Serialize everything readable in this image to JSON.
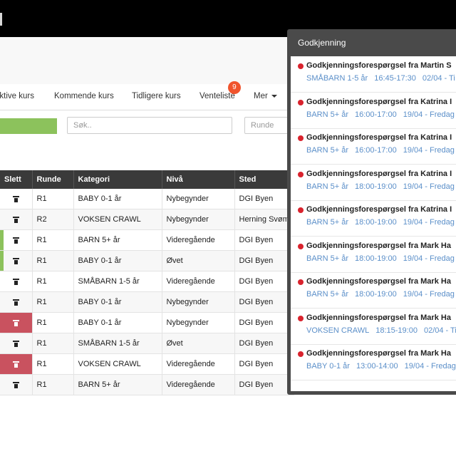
{
  "tabs": [
    {
      "label": "ktive kurs",
      "name": "tab-aktive-kurs"
    },
    {
      "label": "Kommende kurs",
      "name": "tab-kommende-kurs"
    },
    {
      "label": "Tidligere kurs",
      "name": "tab-tidligere-kurs"
    },
    {
      "label": "Venteliste",
      "name": "tab-venteliste",
      "badge": "9"
    },
    {
      "label": "Mer",
      "name": "tab-mer"
    }
  ],
  "search": {
    "placeholder": "Søk.."
  },
  "runde_filter": {
    "placeholder": "Runde"
  },
  "table": {
    "columns": [
      "Slett",
      "Runde",
      "Kategori",
      "Nivå",
      "Sted"
    ],
    "rows": [
      {
        "slett": "",
        "runde": "R1",
        "kategori": "BABY 0-1 år",
        "niva": "Nybegynder",
        "sted": "DGI Byen",
        "state": "normal"
      },
      {
        "slett": "",
        "runde": "R2",
        "kategori": "VOKSEN CRAWL",
        "niva": "Nybegynder",
        "sted": "Herning Svøm",
        "state": "normal"
      },
      {
        "slett": "",
        "runde": "R1",
        "kategori": "BARN 5+ år",
        "niva": "Videregående",
        "sted": "DGI Byen",
        "state": "green"
      },
      {
        "slett": "",
        "runde": "R1",
        "kategori": "BABY 0-1 år",
        "niva": "Øvet",
        "sted": "DGI Byen",
        "state": "green"
      },
      {
        "slett": "",
        "runde": "R1",
        "kategori": "SMÅBARN 1-5 år",
        "niva": "Videregående",
        "sted": "DGI Byen",
        "state": "normal"
      },
      {
        "slett": "",
        "runde": "R1",
        "kategori": "BABY 0-1 år",
        "niva": "Nybegynder",
        "sted": "DGI Byen",
        "state": "normal"
      },
      {
        "slett": "",
        "runde": "R1",
        "kategori": "BABY 0-1 år",
        "niva": "Nybegynder",
        "sted": "DGI Byen",
        "state": "red"
      },
      {
        "slett": "",
        "runde": "R1",
        "kategori": "SMÅBARN 1-5 år",
        "niva": "Øvet",
        "sted": "DGI Byen",
        "state": "normal"
      },
      {
        "slett": "",
        "runde": "R1",
        "kategori": "VOKSEN CRAWL",
        "niva": "Videregående",
        "sted": "DGI Byen",
        "state": "red"
      },
      {
        "slett": "",
        "runde": "R1",
        "kategori": "BARN 5+ år",
        "niva": "Videregående",
        "sted": "DGI Byen",
        "state": "normal"
      }
    ]
  },
  "panel": {
    "title": "Godkjenning",
    "items": [
      {
        "title": "Godkjenningsforespørgsel fra Martin S",
        "category": "SMÅBARN 1-5 år",
        "time": "16:45-17:30",
        "date": "02/04 - Ti"
      },
      {
        "title": "Godkjenningsforespørgsel fra Katrina I",
        "category": "BARN 5+ år",
        "time": "16:00-17:00",
        "date": "19/04 - Fredag"
      },
      {
        "title": "Godkjenningsforespørgsel fra Katrina I",
        "category": "BARN 5+ år",
        "time": "16:00-17:00",
        "date": "19/04 - Fredag"
      },
      {
        "title": "Godkjenningsforespørgsel fra Katrina I",
        "category": "BARN 5+ år",
        "time": "18:00-19:00",
        "date": "19/04 - Fredag"
      },
      {
        "title": "Godkjenningsforespørgsel fra Katrina I",
        "category": "BARN 5+ år",
        "time": "18:00-19:00",
        "date": "19/04 - Fredag"
      },
      {
        "title": "Godkjenningsforespørgsel fra Mark Ha",
        "category": "BARN 5+ år",
        "time": "18:00-19:00",
        "date": "19/04 - Fredag"
      },
      {
        "title": "Godkjenningsforespørgsel fra Mark Ha",
        "category": "BARN 5+ år",
        "time": "18:00-19:00",
        "date": "19/04 - Fredag"
      },
      {
        "title": "Godkjenningsforespørgsel fra Mark Ha",
        "category": "VOKSEN CRAWL",
        "time": "18:15-19:00",
        "date": "02/04 - Ti"
      },
      {
        "title": "Godkjenningsforespørgsel fra Mark Ha",
        "category": "BABY 0-1 år",
        "time": "13:00-14:00",
        "date": "19/04 - Fredag"
      }
    ]
  }
}
